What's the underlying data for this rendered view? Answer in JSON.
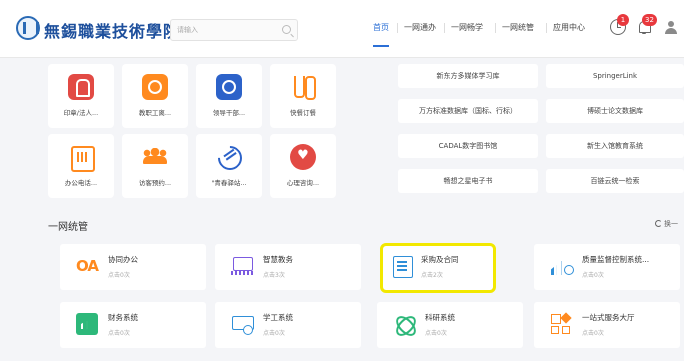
{
  "header": {
    "school_name": "無錫職業技術學院",
    "search_placeholder": "请输入",
    "nav": [
      "首页",
      "一网通办",
      "一网畅学",
      "一网统管",
      "应用中心"
    ],
    "notification_clock_count": "1",
    "notification_bell_count": "32"
  },
  "apps": [
    {
      "label": "印章/法人...",
      "icon": "stamp-icon"
    },
    {
      "label": "教职工离...",
      "icon": "teacher-icon"
    },
    {
      "label": "领导干部...",
      "icon": "leader-icon"
    },
    {
      "label": "快餐订餐",
      "icon": "fork-icon"
    },
    {
      "label": "办公电话...",
      "icon": "phone-icon"
    },
    {
      "label": "访客预约...",
      "icon": "visitor-icon"
    },
    {
      "label": "\"青春驿站...",
      "icon": "hands-icon"
    },
    {
      "label": "心理咨询...",
      "icon": "heart-icon"
    }
  ],
  "databases": [
    "新东方多媒体学习库",
    "SpringerLink",
    "万方标准数据库（国标、行标）",
    "博硕士论文数据库",
    "CADAL数字图书馆",
    "新生入馆教育系统",
    "畅想之星电子书",
    "百链云统一检索"
  ],
  "section": {
    "title": "一网统管",
    "switch_label": "换一"
  },
  "systems": [
    {
      "name": "协同办公",
      "stat": "点击0次",
      "icon": "oa-icon",
      "icon_text": "OA"
    },
    {
      "name": "智慧教务",
      "stat": "点击3次",
      "icon": "edu-icon"
    },
    {
      "name": "采购及合同",
      "stat": "点击2次",
      "icon": "purchase-icon",
      "highlighted": true
    },
    {
      "name": "质量监督控制系统...",
      "stat": "点击0次",
      "icon": "quality-icon"
    },
    {
      "name": "财务系统",
      "stat": "点击0次",
      "icon": "finance-icon"
    },
    {
      "name": "学工系统",
      "stat": "点击0次",
      "icon": "student-icon"
    },
    {
      "name": "科研系统",
      "stat": "点击0次",
      "icon": "research-icon"
    },
    {
      "name": "一站式服务大厅",
      "stat": "点击0次",
      "icon": "service-icon"
    }
  ],
  "colors": {
    "brand_blue": "#1d4f9c",
    "active_nav": "#2b6fd6",
    "badge_red": "#e8383d",
    "highlight_yellow": "#f2e800"
  }
}
